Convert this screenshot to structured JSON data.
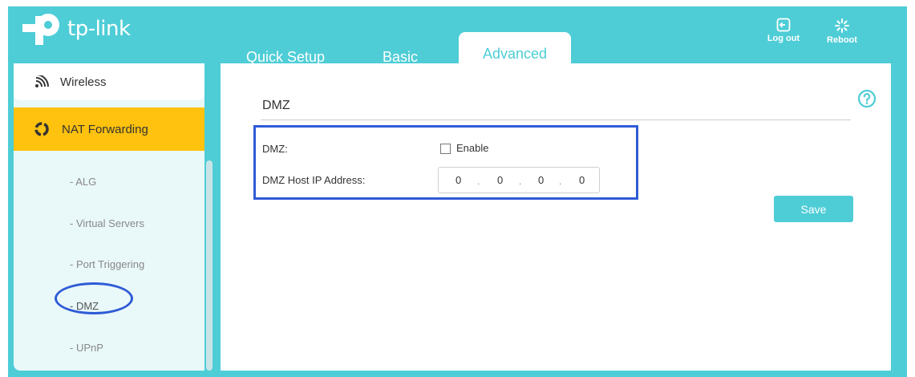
{
  "brand": {
    "logo_text": "tp-link"
  },
  "tabs": [
    {
      "label": "Quick Setup"
    },
    {
      "label": "Basic"
    },
    {
      "label": "Advanced"
    }
  ],
  "top_buttons": {
    "logout": "Log out",
    "reboot": "Reboot"
  },
  "sidebar": {
    "wireless": "Wireless",
    "nat_forwarding": "NAT Forwarding",
    "sub_items": [
      "- ALG",
      "- Virtual Servers",
      "- Port Triggering",
      "- DMZ",
      "- UPnP"
    ]
  },
  "main": {
    "section_title": "DMZ",
    "dmz_label": "DMZ:",
    "enable_label": "Enable",
    "enable_checked": false,
    "ip_label": "DMZ Host IP Address:",
    "ip_octets": [
      "0",
      "0",
      "0",
      "0"
    ],
    "ip_separator": ".",
    "save_label": "Save"
  },
  "colors": {
    "accent": "#4ecdd6",
    "active": "#ffc20e",
    "highlight": "#2e5bd6"
  }
}
